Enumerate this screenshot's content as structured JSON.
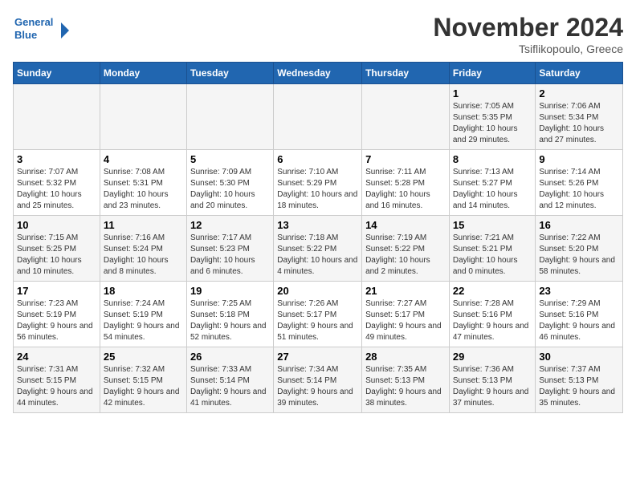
{
  "header": {
    "logo_line1": "General",
    "logo_line2": "Blue",
    "month_title": "November 2024",
    "location": "Tsiflikopoulo, Greece"
  },
  "weekdays": [
    "Sunday",
    "Monday",
    "Tuesday",
    "Wednesday",
    "Thursday",
    "Friday",
    "Saturday"
  ],
  "weeks": [
    [
      {
        "day": "",
        "info": ""
      },
      {
        "day": "",
        "info": ""
      },
      {
        "day": "",
        "info": ""
      },
      {
        "day": "",
        "info": ""
      },
      {
        "day": "",
        "info": ""
      },
      {
        "day": "1",
        "info": "Sunrise: 7:05 AM\nSunset: 5:35 PM\nDaylight: 10 hours and 29 minutes."
      },
      {
        "day": "2",
        "info": "Sunrise: 7:06 AM\nSunset: 5:34 PM\nDaylight: 10 hours and 27 minutes."
      }
    ],
    [
      {
        "day": "3",
        "info": "Sunrise: 7:07 AM\nSunset: 5:32 PM\nDaylight: 10 hours and 25 minutes."
      },
      {
        "day": "4",
        "info": "Sunrise: 7:08 AM\nSunset: 5:31 PM\nDaylight: 10 hours and 23 minutes."
      },
      {
        "day": "5",
        "info": "Sunrise: 7:09 AM\nSunset: 5:30 PM\nDaylight: 10 hours and 20 minutes."
      },
      {
        "day": "6",
        "info": "Sunrise: 7:10 AM\nSunset: 5:29 PM\nDaylight: 10 hours and 18 minutes."
      },
      {
        "day": "7",
        "info": "Sunrise: 7:11 AM\nSunset: 5:28 PM\nDaylight: 10 hours and 16 minutes."
      },
      {
        "day": "8",
        "info": "Sunrise: 7:13 AM\nSunset: 5:27 PM\nDaylight: 10 hours and 14 minutes."
      },
      {
        "day": "9",
        "info": "Sunrise: 7:14 AM\nSunset: 5:26 PM\nDaylight: 10 hours and 12 minutes."
      }
    ],
    [
      {
        "day": "10",
        "info": "Sunrise: 7:15 AM\nSunset: 5:25 PM\nDaylight: 10 hours and 10 minutes."
      },
      {
        "day": "11",
        "info": "Sunrise: 7:16 AM\nSunset: 5:24 PM\nDaylight: 10 hours and 8 minutes."
      },
      {
        "day": "12",
        "info": "Sunrise: 7:17 AM\nSunset: 5:23 PM\nDaylight: 10 hours and 6 minutes."
      },
      {
        "day": "13",
        "info": "Sunrise: 7:18 AM\nSunset: 5:22 PM\nDaylight: 10 hours and 4 minutes."
      },
      {
        "day": "14",
        "info": "Sunrise: 7:19 AM\nSunset: 5:22 PM\nDaylight: 10 hours and 2 minutes."
      },
      {
        "day": "15",
        "info": "Sunrise: 7:21 AM\nSunset: 5:21 PM\nDaylight: 10 hours and 0 minutes."
      },
      {
        "day": "16",
        "info": "Sunrise: 7:22 AM\nSunset: 5:20 PM\nDaylight: 9 hours and 58 minutes."
      }
    ],
    [
      {
        "day": "17",
        "info": "Sunrise: 7:23 AM\nSunset: 5:19 PM\nDaylight: 9 hours and 56 minutes."
      },
      {
        "day": "18",
        "info": "Sunrise: 7:24 AM\nSunset: 5:19 PM\nDaylight: 9 hours and 54 minutes."
      },
      {
        "day": "19",
        "info": "Sunrise: 7:25 AM\nSunset: 5:18 PM\nDaylight: 9 hours and 52 minutes."
      },
      {
        "day": "20",
        "info": "Sunrise: 7:26 AM\nSunset: 5:17 PM\nDaylight: 9 hours and 51 minutes."
      },
      {
        "day": "21",
        "info": "Sunrise: 7:27 AM\nSunset: 5:17 PM\nDaylight: 9 hours and 49 minutes."
      },
      {
        "day": "22",
        "info": "Sunrise: 7:28 AM\nSunset: 5:16 PM\nDaylight: 9 hours and 47 minutes."
      },
      {
        "day": "23",
        "info": "Sunrise: 7:29 AM\nSunset: 5:16 PM\nDaylight: 9 hours and 46 minutes."
      }
    ],
    [
      {
        "day": "24",
        "info": "Sunrise: 7:31 AM\nSunset: 5:15 PM\nDaylight: 9 hours and 44 minutes."
      },
      {
        "day": "25",
        "info": "Sunrise: 7:32 AM\nSunset: 5:15 PM\nDaylight: 9 hours and 42 minutes."
      },
      {
        "day": "26",
        "info": "Sunrise: 7:33 AM\nSunset: 5:14 PM\nDaylight: 9 hours and 41 minutes."
      },
      {
        "day": "27",
        "info": "Sunrise: 7:34 AM\nSunset: 5:14 PM\nDaylight: 9 hours and 39 minutes."
      },
      {
        "day": "28",
        "info": "Sunrise: 7:35 AM\nSunset: 5:13 PM\nDaylight: 9 hours and 38 minutes."
      },
      {
        "day": "29",
        "info": "Sunrise: 7:36 AM\nSunset: 5:13 PM\nDaylight: 9 hours and 37 minutes."
      },
      {
        "day": "30",
        "info": "Sunrise: 7:37 AM\nSunset: 5:13 PM\nDaylight: 9 hours and 35 minutes."
      }
    ]
  ]
}
